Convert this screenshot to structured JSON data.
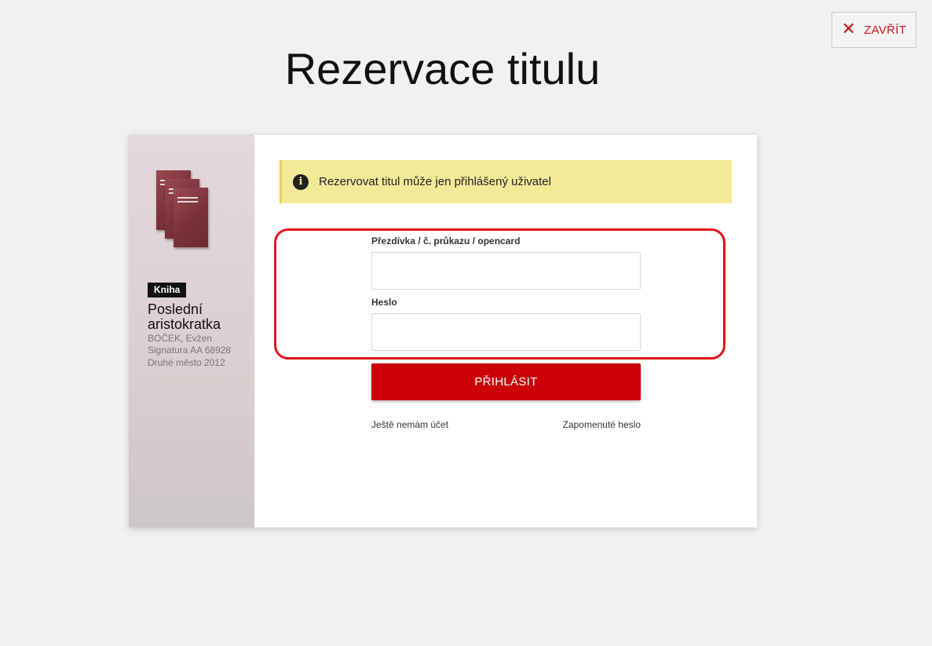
{
  "header": {
    "title": "Rezervace titulu",
    "close_label": "ZAVŘÍT",
    "close_icon": "close-icon"
  },
  "book": {
    "type_badge": "Kniha",
    "title": "Poslední aristokratka",
    "author": "BOČEK, Evžen",
    "signature": "Signatura AA 68928",
    "publisher": "Druhé město 2012"
  },
  "alert": {
    "icon": "info-icon",
    "text": "Rezervovat titul může jen přihlášený uživatel"
  },
  "login": {
    "username_label": "Přezdívka / č. průkazu / opencard",
    "username_value": "",
    "password_label": "Heslo",
    "password_value": "",
    "submit_label": "PŘIHLÁSIT",
    "register_link": "Ještě nemám účet",
    "forgot_link": "Zapomenuté heslo"
  },
  "colors": {
    "accent": "#cc0006",
    "alert_bg": "#f3ea98",
    "highlight": "#e3111b"
  }
}
